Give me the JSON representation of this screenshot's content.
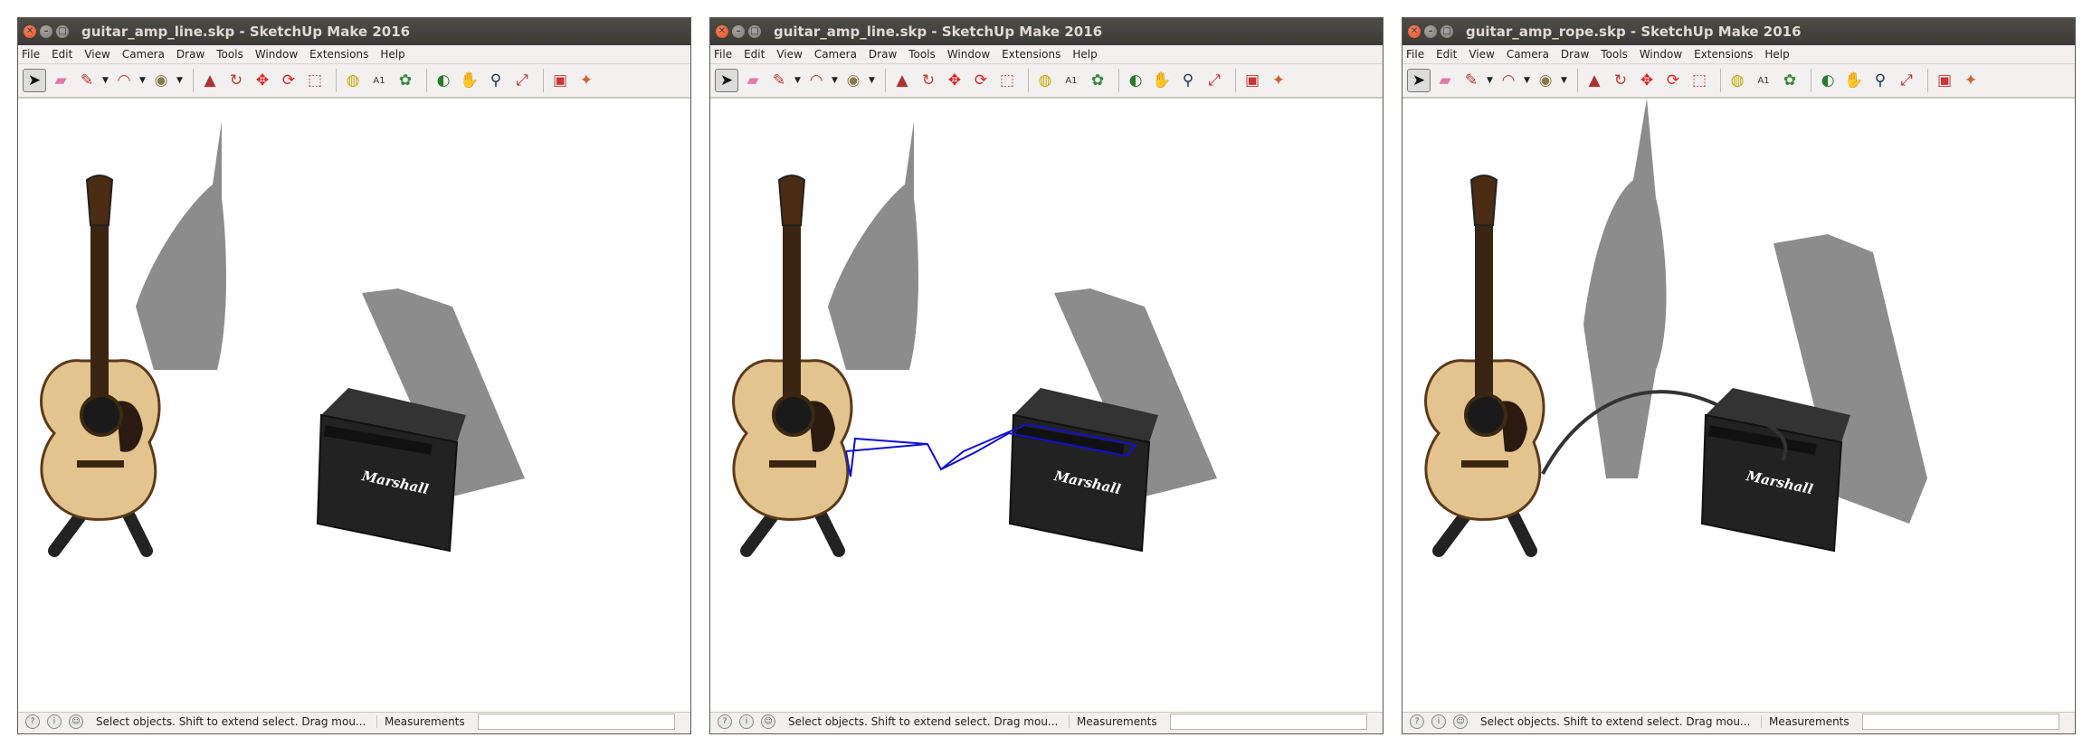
{
  "windows": [
    {
      "title": "guitar_amp_line.skp - SketchUp Make 2016",
      "scene": "line",
      "status": "Select objects. Shift to extend select. Drag mou...",
      "measurements_label": "Measurements",
      "measurements_value": ""
    },
    {
      "title": "guitar_amp_line.skp - SketchUp Make 2016",
      "scene": "line-drawn",
      "status": "Select objects. Shift to extend select. Drag mou...",
      "measurements_label": "Measurements",
      "measurements_value": ""
    },
    {
      "title": "guitar_amp_rope.skp - SketchUp Make 2016",
      "scene": "rope",
      "status": "Select objects. Shift to extend select. Drag mou...",
      "measurements_label": "Measurements",
      "measurements_value": ""
    }
  ],
  "menu": [
    "File",
    "Edit",
    "View",
    "Camera",
    "Draw",
    "Tools",
    "Window",
    "Extensions",
    "Help"
  ],
  "amp_brand": "Marshall",
  "toolbar_icons": [
    "select-icon",
    "eraser-icon",
    "pencil-icon",
    "arc-icon",
    "paint-bucket-icon",
    "push-pull-icon",
    "follow-me-icon",
    "move-icon",
    "rotate-icon",
    "offset-icon",
    "tape-measure-icon",
    "text-icon",
    "paint-icon",
    "orbit-icon",
    "pan-icon",
    "zoom-icon",
    "zoom-extents-icon",
    "warehouse-icon",
    "extension-icon"
  ],
  "colors": {
    "titlebar": "#3c3b37",
    "selected_line": "#1010d0",
    "shadow": "#8c8c8c",
    "guitar_body": "#e4c48e",
    "amp": "#222222"
  }
}
